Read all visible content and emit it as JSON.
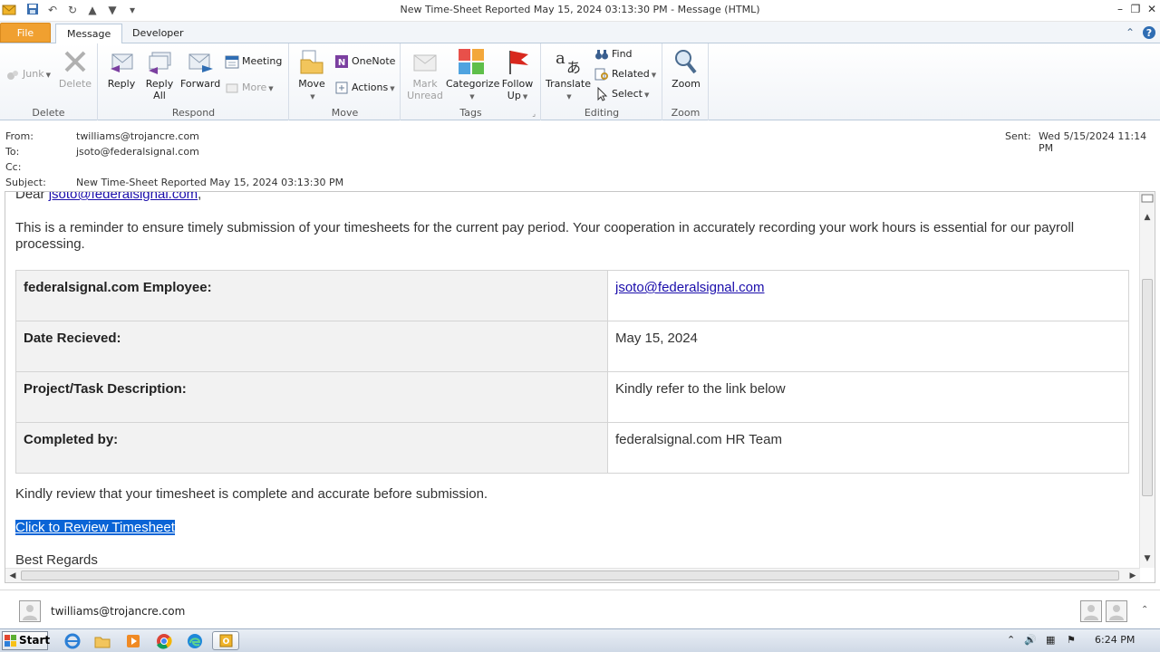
{
  "window": {
    "title": "New Time-Sheet Reported May 15, 2024 03:13:30 PM  -  Message (HTML)"
  },
  "tabs": {
    "file": "File",
    "message": "Message",
    "developer": "Developer"
  },
  "ribbon": {
    "delete_group": {
      "label": "Delete",
      "junk": "Junk",
      "delete": "Delete"
    },
    "respond_group": {
      "label": "Respond",
      "reply": "Reply",
      "reply_all_1": "Reply",
      "reply_all_2": "All",
      "forward": "Forward",
      "meeting": "Meeting",
      "more": "More"
    },
    "move_group": {
      "label": "Move",
      "move": "Move",
      "onenote": "OneNote",
      "actions": "Actions"
    },
    "tags_group": {
      "label": "Tags",
      "mark_1": "Mark",
      "mark_2": "Unread",
      "categorize": "Categorize",
      "follow_1": "Follow",
      "follow_2": "Up"
    },
    "editing_group": {
      "label": "Editing",
      "translate": "Translate",
      "find": "Find",
      "related": "Related",
      "select": "Select"
    },
    "zoom_group": {
      "label": "Zoom",
      "zoom": "Zoom"
    }
  },
  "header": {
    "from_label": "From:",
    "from": "twilliams@trojancre.com",
    "to_label": "To:",
    "to": "jsoto@federalsignal.com",
    "cc_label": "Cc:",
    "subject_label": "Subject:",
    "subject": "New Time-Sheet Reported May 15, 2024 03:13:30 PM",
    "sent_label": "Sent:",
    "sent": "Wed 5/15/2024 11:14 PM"
  },
  "body": {
    "greeting_prefix": "Dear ",
    "greeting_link": "jsoto@federalsignal.com",
    "greeting_suffix": ",",
    "intro": "This is a reminder to ensure timely submission of your timesheets for the current pay period. Your cooperation in accurately recording your work hours is essential for our payroll processing.",
    "table": [
      {
        "key": "federalsignal.com Employee:",
        "value": "jsoto@federalsignal.com"
      },
      {
        "key": "Date Recieved:",
        "value": "May 15, 2024"
      },
      {
        "key": "Project/Task Description:",
        "value": "Kindly refer to the link below"
      },
      {
        "key": "Completed by:",
        "value": "federalsignal.com HR Team"
      }
    ],
    "review": "Kindly review that your timesheet is complete and accurate before submission.",
    "link": "Click to Review Timesheet",
    "closing": "Best Regards"
  },
  "people_pane": {
    "sender": "twilliams@trojancre.com"
  },
  "taskbar": {
    "start": "Start",
    "clock": "6:24 PM"
  },
  "colors": {
    "file_tab": "#f0a030",
    "link": "#1a0dab",
    "selection": "#0a64d6"
  }
}
